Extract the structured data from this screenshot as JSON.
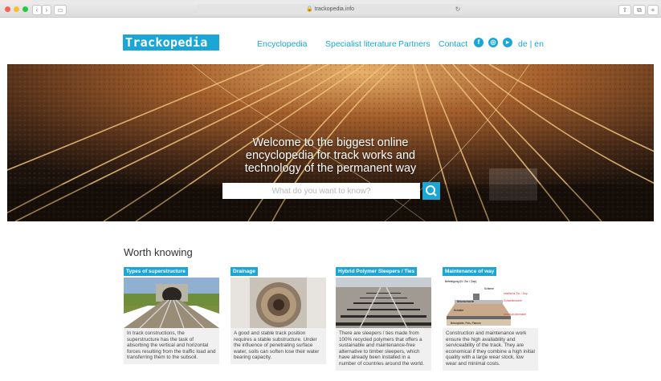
{
  "browser": {
    "url": "trackopedia.info"
  },
  "site": {
    "logo": "Trackopedia",
    "nav": [
      "Encyclopedia",
      "Specialist literature",
      "Partners",
      "Contact"
    ],
    "lang": "de | en"
  },
  "hero": {
    "title_line1": "Welcome to the biggest online",
    "title_line2": "encyclopedia for track works and",
    "title_line3": "technology of the permanent way",
    "search_placeholder": "What do you want to know?"
  },
  "worth": {
    "heading": "Worth knowing",
    "cards": [
      {
        "tag": "Types of superstructure",
        "text": "In track constructions, the superstructure has the task of absorbing the vertical and horizontal forces resulting from the traffic load and transferring them to the subsoil."
      },
      {
        "tag": "Drainage",
        "text": "A good and stable track position requires a stable substructure. Under the influence of penetrating surface water, soils can soften lose their water bearing capacity."
      },
      {
        "tag": "Hybrid Polymer Sleepers / Ties",
        "text": "There are sleepers / ties made from 100% recycled polymers that offers a sustainable and maintenance-free alternative to timber sleepers, which have already been installed in a number of countries around the world."
      },
      {
        "tag": "Maintenance of way",
        "text": "Construction and maintenance work ensure the high availability and serviceability of the track. They are economical if they combine a high initial quality with a large wear stock, low wear and minimal costs."
      }
    ],
    "diagram_labels": [
      "Befestigung (Kl. Zw. / Zwp)",
      "Schiene",
      "elastische Zw. / Zwp",
      "Betonschwelle",
      "Schwellensohle",
      "Schotter",
      "Unterschottermatte",
      "Betonplatte, Fels, Planum"
    ]
  },
  "colors": {
    "accent": "#1aa7d8"
  }
}
